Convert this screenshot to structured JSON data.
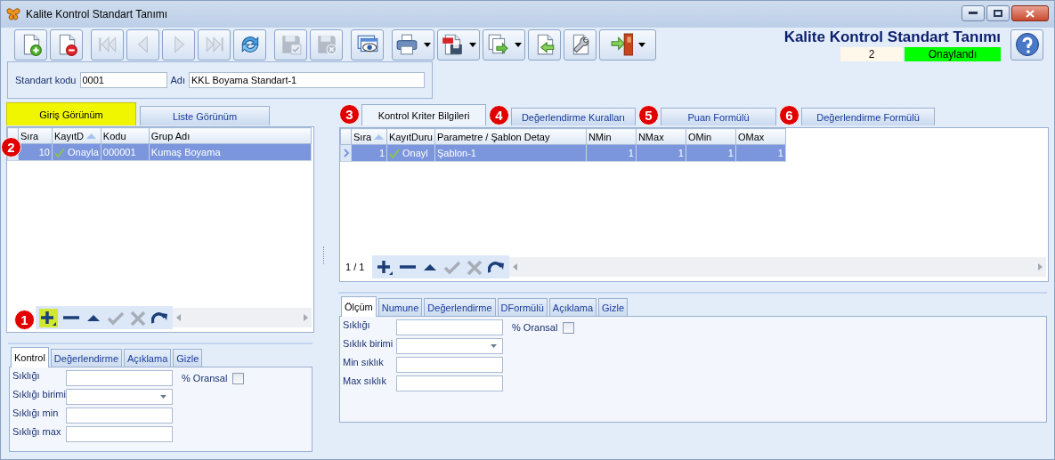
{
  "window": {
    "title": "Kalite Kontrol Standart Tanımı"
  },
  "toolbar": [
    {
      "kind": "new",
      "disabled": false
    },
    {
      "kind": "delete",
      "disabled": false
    },
    {
      "kind": "first",
      "disabled": true
    },
    {
      "kind": "prev",
      "disabled": true
    },
    {
      "kind": "next",
      "disabled": true
    },
    {
      "kind": "last",
      "disabled": true
    },
    {
      "kind": "refresh",
      "disabled": false
    },
    {
      "kind": "save",
      "disabled": true
    },
    {
      "kind": "discard",
      "disabled": true
    },
    {
      "kind": "preview",
      "disabled": false
    },
    {
      "kind": "print",
      "disabled": false,
      "dropdown": true
    },
    {
      "kind": "pdf",
      "disabled": false,
      "dropdown": true
    },
    {
      "kind": "export",
      "disabled": false,
      "dropdown": true
    },
    {
      "kind": "import",
      "disabled": false
    },
    {
      "kind": "tools",
      "disabled": false
    },
    {
      "kind": "exit",
      "disabled": false,
      "dropdown": true
    }
  ],
  "heading": {
    "title": "Kalite Kontrol Standart Tanımı",
    "count": "2",
    "status": "Onaylandı"
  },
  "header_form": [
    {
      "label": "Standart kodu",
      "value": "0001"
    },
    {
      "label": "Adı",
      "value": "KKL Boyama Standart-1"
    }
  ],
  "left": {
    "view_tabs": [
      {
        "label": "Giriş Görünüm",
        "selected": true
      },
      {
        "label": "Liste Görünüm",
        "selected": false
      }
    ],
    "grid": {
      "badge": "2",
      "columns": [
        {
          "label": "Sıra",
          "sorted": false
        },
        {
          "label": "KayıtD",
          "sorted": true
        },
        {
          "label": "Kodu",
          "sorted": false
        },
        {
          "label": "Grup Adı",
          "sorted": false
        }
      ],
      "rows": [
        {
          "selected": true,
          "cells": [
            "10",
            "Onayla",
            "000001",
            "Kumaş Boyama"
          ]
        }
      ]
    },
    "nav": {
      "badge": "1",
      "buttons": [
        {
          "kind": "add",
          "highlighted": true,
          "disabled": false
        },
        {
          "kind": "remove",
          "highlighted": false,
          "disabled": false
        },
        {
          "kind": "up",
          "highlighted": false,
          "disabled": false
        },
        {
          "kind": "confirm",
          "highlighted": false,
          "disabled": true
        },
        {
          "kind": "cancel",
          "highlighted": false,
          "disabled": true
        },
        {
          "kind": "redo",
          "highlighted": false,
          "disabled": false
        }
      ]
    },
    "detail_tabs": [
      {
        "label": "Kontrol",
        "selected": true
      },
      {
        "label": "Değerlendirme",
        "selected": false
      },
      {
        "label": "Açıklama",
        "selected": false
      },
      {
        "label": "Gizle",
        "selected": false
      }
    ],
    "form": {
      "fields": [
        {
          "label": "Sıklığı",
          "kind": "text"
        },
        {
          "label": "Sıklığı birimi",
          "kind": "dropdown"
        },
        {
          "label": "Sıklığı min",
          "kind": "text"
        },
        {
          "label": "Sıklığı max",
          "kind": "text"
        }
      ],
      "checkbox": {
        "label": "% Oransal",
        "checked": false
      }
    }
  },
  "right": {
    "tabs": [
      {
        "badge": "3",
        "label": "Kontrol Kriter Bilgileri",
        "selected": true
      },
      {
        "badge": "4",
        "label": "Değerlendirme Kuralları",
        "selected": false
      },
      {
        "badge": "5",
        "label": "Puan Formülü",
        "selected": false
      },
      {
        "badge": "6",
        "label": "Değerlendirme Formülü",
        "selected": false
      }
    ],
    "grid": {
      "columns": [
        {
          "label": "Sıra",
          "sorted": true
        },
        {
          "label": "KayıtDuru",
          "sorted": false
        },
        {
          "label": "Parametre / Şablon Detay",
          "sorted": false
        },
        {
          "label": "NMin",
          "sorted": false
        },
        {
          "label": "NMax",
          "sorted": false
        },
        {
          "label": "OMin",
          "sorted": false
        },
        {
          "label": "OMax",
          "sorted": false
        }
      ],
      "rows": [
        {
          "selected": true,
          "cells": [
            "1",
            "Onayl",
            "Şablon-1",
            "1",
            "1",
            "1",
            "1"
          ]
        }
      ]
    },
    "nav": {
      "page": "1 / 1",
      "buttons": [
        {
          "kind": "add",
          "highlighted": false,
          "disabled": false
        },
        {
          "kind": "remove",
          "highlighted": false,
          "disabled": false
        },
        {
          "kind": "up",
          "highlighted": false,
          "disabled": false
        },
        {
          "kind": "confirm",
          "highlighted": false,
          "disabled": true
        },
        {
          "kind": "cancel",
          "highlighted": false,
          "disabled": true
        },
        {
          "kind": "redo",
          "highlighted": false,
          "disabled": false
        }
      ]
    },
    "detail_tabs": [
      {
        "label": "Ölçüm",
        "selected": true
      },
      {
        "label": "Numune",
        "selected": false
      },
      {
        "label": "Değerlendirme",
        "selected": false
      },
      {
        "label": "DFormülü",
        "selected": false
      },
      {
        "label": "Açıklama",
        "selected": false
      },
      {
        "label": "Gizle",
        "selected": false
      }
    ],
    "form": {
      "fields": [
        {
          "label": "Sıklığı",
          "kind": "text"
        },
        {
          "label": "Sıklık birimi",
          "kind": "dropdown"
        },
        {
          "label": "Min sıklık",
          "kind": "text"
        },
        {
          "label": "Max sıklık",
          "kind": "text"
        }
      ],
      "checkbox": {
        "label": "% Oransal",
        "checked": false
      }
    }
  }
}
